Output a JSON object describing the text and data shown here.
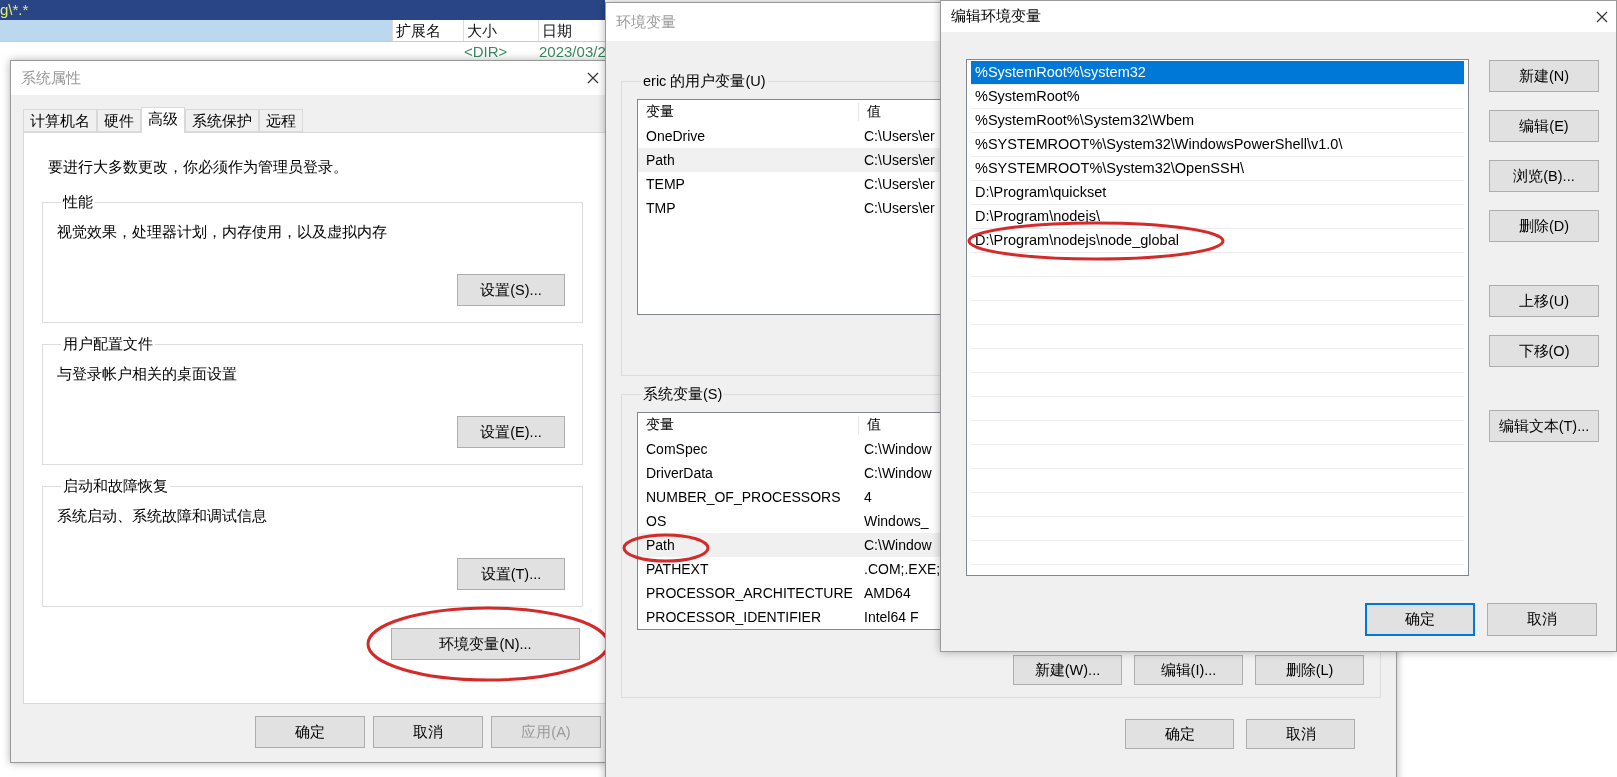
{
  "file_manager": {
    "path": "g\\*.*",
    "columns": [
      "扩展名",
      "大小",
      "日期"
    ],
    "row": {
      "size": "<DIR>",
      "date": "2023/03/2"
    }
  },
  "system_properties": {
    "title": "系统属性",
    "tabs": [
      {
        "label": "计算机名",
        "selected": false
      },
      {
        "label": "硬件",
        "selected": false
      },
      {
        "label": "高级",
        "selected": true
      },
      {
        "label": "系统保护",
        "selected": false
      },
      {
        "label": "远程",
        "selected": false
      }
    ],
    "notice": "要进行大多数更改，你必须作为管理员登录。",
    "groups": [
      {
        "title": "性能",
        "description": "视觉效果，处理器计划，内存使用，以及虚拟内存",
        "button": "设置(S)..."
      },
      {
        "title": "用户配置文件",
        "description": "与登录帐户相关的桌面设置",
        "button": "设置(E)..."
      },
      {
        "title": "启动和故障恢复",
        "description": "系统启动、系统故障和调试信息",
        "button": "设置(T)..."
      }
    ],
    "env_button": {
      "label": "环境变量(N)...",
      "circled": true
    },
    "buttons": [
      {
        "label": "确定",
        "disabled": false
      },
      {
        "label": "取消",
        "disabled": false
      },
      {
        "label": "应用(A)",
        "disabled": true
      }
    ]
  },
  "environment_variables": {
    "title": "环境变量",
    "user_group": {
      "title": "eric 的用户变量(U)",
      "columns": [
        "变量",
        "值"
      ],
      "rows": [
        {
          "name": "OneDrive",
          "value": "C:\\Users\\er",
          "selected": false,
          "circled": false
        },
        {
          "name": "Path",
          "value": "C:\\Users\\er",
          "selected": true,
          "circled": false
        },
        {
          "name": "TEMP",
          "value": "C:\\Users\\er",
          "selected": false,
          "circled": false
        },
        {
          "name": "TMP",
          "value": "C:\\Users\\er",
          "selected": false,
          "circled": false
        }
      ]
    },
    "system_group": {
      "title": "系统变量(S)",
      "columns": [
        "变量",
        "值"
      ],
      "rows": [
        {
          "name": "ComSpec",
          "value": "C:\\Window",
          "selected": false,
          "circled": false
        },
        {
          "name": "DriverData",
          "value": "C:\\Window",
          "selected": false,
          "circled": false
        },
        {
          "name": "NUMBER_OF_PROCESSORS",
          "value": "4",
          "selected": false,
          "circled": false
        },
        {
          "name": "OS",
          "value": "Windows_",
          "selected": false,
          "circled": false
        },
        {
          "name": "Path",
          "value": "C:\\Window",
          "selected": true,
          "circled": true
        },
        {
          "name": "PATHEXT",
          "value": ".COM;.EXE;",
          "selected": false,
          "circled": false
        },
        {
          "name": "PROCESSOR_ARCHITECTURE",
          "value": "AMD64",
          "selected": false,
          "circled": false
        },
        {
          "name": "PROCESSOR_IDENTIFIER",
          "value": "Intel64 F",
          "selected": false,
          "circled": false
        }
      ],
      "buttons": [
        "新建(W)...",
        "编辑(I)...",
        "删除(L)"
      ]
    },
    "buttons": [
      "确定",
      "取消"
    ]
  },
  "edit_dialog": {
    "title": "编辑环境变量",
    "entries": [
      {
        "text": "%SystemRoot%\\system32",
        "selected": true,
        "circled": false
      },
      {
        "text": "%SystemRoot%",
        "selected": false,
        "circled": false
      },
      {
        "text": "%SystemRoot%\\System32\\Wbem",
        "selected": false,
        "circled": false
      },
      {
        "text": "%SYSTEMROOT%\\System32\\WindowsPowerShell\\v1.0\\",
        "selected": false,
        "circled": false
      },
      {
        "text": "%SYSTEMROOT%\\System32\\OpenSSH\\",
        "selected": false,
        "circled": false
      },
      {
        "text": "D:\\Program\\quickset",
        "selected": false,
        "circled": false
      },
      {
        "text": "D:\\Program\\nodejs\\",
        "selected": false,
        "circled": false
      },
      {
        "text": "D:\\Program\\nodejs\\node_global",
        "selected": false,
        "circled": true
      }
    ],
    "button_groups": [
      [
        "新建(N)",
        "编辑(E)",
        "浏览(B)...",
        "删除(D)"
      ],
      [
        "上移(U)",
        "下移(O)"
      ],
      [
        "编辑文本(T)..."
      ]
    ],
    "buttons": [
      {
        "label": "确定",
        "focused": true
      },
      {
        "label": "取消",
        "focused": false
      }
    ]
  }
}
